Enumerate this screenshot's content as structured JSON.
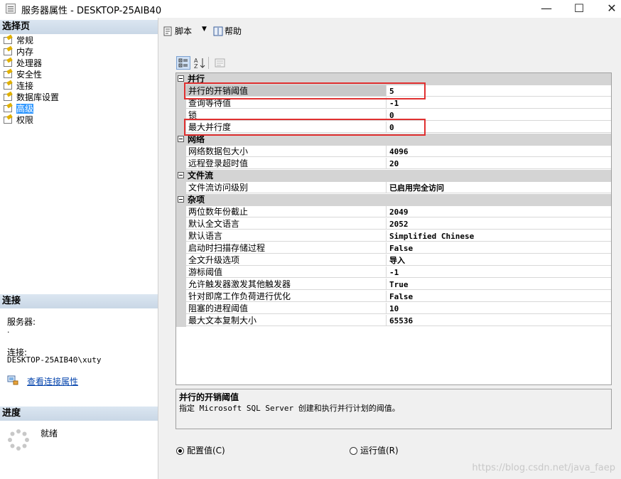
{
  "window": {
    "title": "服务器属性 - DESKTOP-25AIB40",
    "minimize": "—",
    "maximize": "☐",
    "close": "✕"
  },
  "sidebar": {
    "select_page_header": "选择页",
    "pages": [
      {
        "label": "常规",
        "icon": "page-wrench-icon"
      },
      {
        "label": "内存",
        "icon": "page-wrench-icon"
      },
      {
        "label": "处理器",
        "icon": "page-wrench-icon"
      },
      {
        "label": "安全性",
        "icon": "page-wrench-icon"
      },
      {
        "label": "连接",
        "icon": "page-wrench-icon"
      },
      {
        "label": "数据库设置",
        "icon": "page-wrench-icon"
      },
      {
        "label": "高级",
        "icon": "page-wrench-icon",
        "selected": true
      },
      {
        "label": "权限",
        "icon": "page-wrench-icon"
      }
    ],
    "connection_header": "连接",
    "server_label": "服务器:",
    "server_value": ".",
    "connection_label": "连接:",
    "connection_value": "DESKTOP-25AIB40\\xuty",
    "view_connection_link": "查看连接属性",
    "progress_header": "进度",
    "progress_status": "就绪"
  },
  "toolbar": {
    "script_label": "脚本",
    "help_label": "帮助"
  },
  "grid": {
    "categories": [
      {
        "name": "并行",
        "rows": [
          {
            "name": "并行的开销阈值",
            "value": "5",
            "selected": true
          },
          {
            "name": "查询等待值",
            "value": "-1"
          },
          {
            "name": "锁",
            "value": "0"
          },
          {
            "name": "最大并行度",
            "value": "0"
          }
        ]
      },
      {
        "name": "网络",
        "rows": [
          {
            "name": "网络数据包大小",
            "value": "4096"
          },
          {
            "name": "远程登录超时值",
            "value": "20"
          }
        ]
      },
      {
        "name": "文件流",
        "rows": [
          {
            "name": "文件流访问级别",
            "value": "已启用完全访问"
          }
        ]
      },
      {
        "name": "杂项",
        "rows": [
          {
            "name": "两位数年份截止",
            "value": "2049"
          },
          {
            "name": "默认全文语言",
            "value": "2052"
          },
          {
            "name": "默认语言",
            "value": "Simplified Chinese"
          },
          {
            "name": "启动时扫描存储过程",
            "value": "False"
          },
          {
            "name": "全文升级选项",
            "value": "导入"
          },
          {
            "name": "游标阈值",
            "value": "-1"
          },
          {
            "name": "允许触发器激发其他触发器",
            "value": "True"
          },
          {
            "name": "针对即席工作负荷进行优化",
            "value": "False"
          },
          {
            "name": "阻塞的进程阈值",
            "value": "10"
          },
          {
            "name": "最大文本复制大小",
            "value": "65536"
          }
        ]
      }
    ]
  },
  "description": {
    "title": "并行的开销阈值",
    "text": "指定 Microsoft SQL Server 创建和执行并行计划的阈值。"
  },
  "options": {
    "configured_label": "配置值(C)",
    "running_label": "运行值(R)",
    "selected": "configured"
  },
  "watermark": "https://blog.csdn.net/java_faep"
}
